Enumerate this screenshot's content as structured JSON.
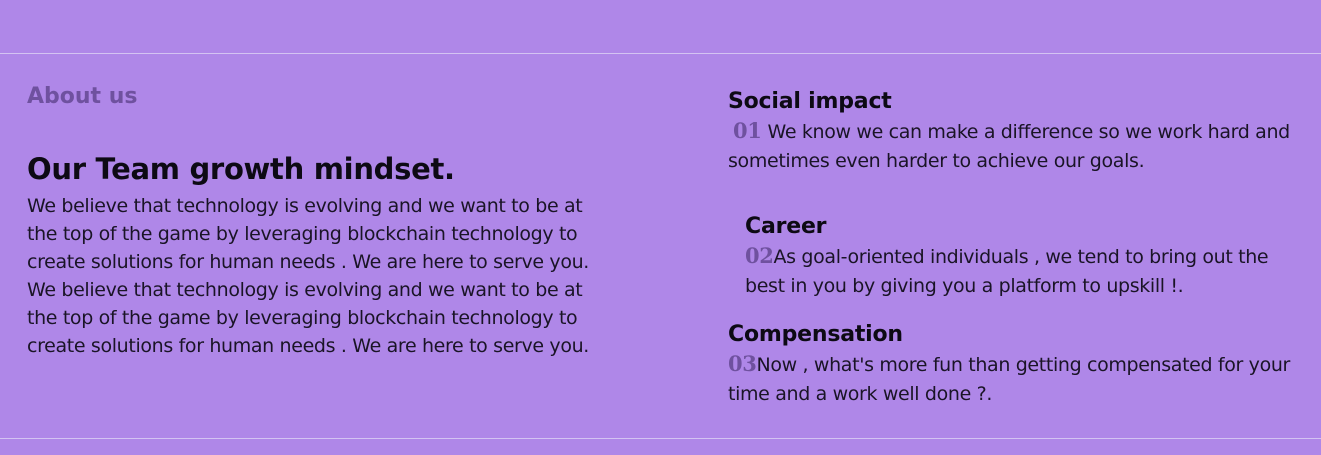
{
  "about": {
    "label": "About us",
    "heading": "Our Team growth mindset.",
    "paragraphs": [
      "We believe that technology is evolving and we want to be at the top of the game by leveraging blockchain technology to create solutions for human needs . We are here to serve you.",
      "We believe that technology is evolving and we want to be at the top of the game by leveraging blockchain technology to create solutions for human needs . We are here to serve you."
    ]
  },
  "values": [
    {
      "title": "Social impact",
      "number": "01",
      "text": "We know we can make a difference so we work hard and sometimes even harder to achieve our goals."
    },
    {
      "title": "Career",
      "number": "02",
      "text": "As goal-oriented individuals , we tend to bring out the best in you by giving you a platform to upskill !."
    },
    {
      "title": "Compensation",
      "number": "03",
      "text": "Now , what's more fun than getting compensated for your time and a work well done ?."
    }
  ],
  "colors": {
    "background": "#af87e8",
    "accent": "#6f519f",
    "divider": "#d4c3f2"
  }
}
